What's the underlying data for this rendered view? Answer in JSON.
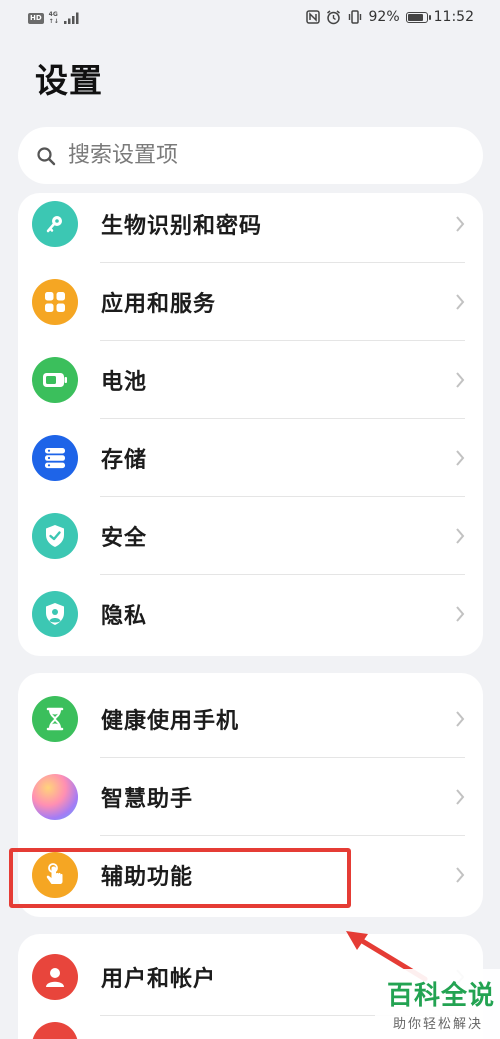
{
  "status_bar": {
    "hd": "HD",
    "network_top": "4G",
    "network_bottom": "↑↓",
    "battery": "92%",
    "time": "11:52"
  },
  "page": {
    "title": "设置"
  },
  "search": {
    "placeholder": "搜索设置项",
    "icon": "search-icon"
  },
  "groups": [
    {
      "items": [
        {
          "label": "生物识别和密码",
          "icon": "key-icon",
          "color": "#3cc7b3"
        },
        {
          "label": "应用和服务",
          "icon": "apps-grid-icon",
          "color": "#f5a623"
        },
        {
          "label": "电池",
          "icon": "battery-icon",
          "color": "#3bbf5c"
        },
        {
          "label": "存储",
          "icon": "storage-icon",
          "color": "#1e64e8"
        },
        {
          "label": "安全",
          "icon": "shield-check-icon",
          "color": "#3cc7b3"
        },
        {
          "label": "隐私",
          "icon": "privacy-shield-icon",
          "color": "#3cc7b3"
        }
      ]
    },
    {
      "items": [
        {
          "label": "健康使用手机",
          "icon": "hourglass-icon",
          "color": "#3bbf5c"
        },
        {
          "label": "智慧助手",
          "icon": "assistant-orb-icon",
          "color": "#b07cf0"
        },
        {
          "label": "辅助功能",
          "icon": "hand-touch-icon",
          "color": "#f5a623"
        }
      ]
    },
    {
      "items": [
        {
          "label": "用户和帐户",
          "icon": "user-icon",
          "color": "#e8453c"
        }
      ]
    }
  ],
  "watermark": {
    "title": "百科全说",
    "subtitle": "助你轻松解决"
  }
}
